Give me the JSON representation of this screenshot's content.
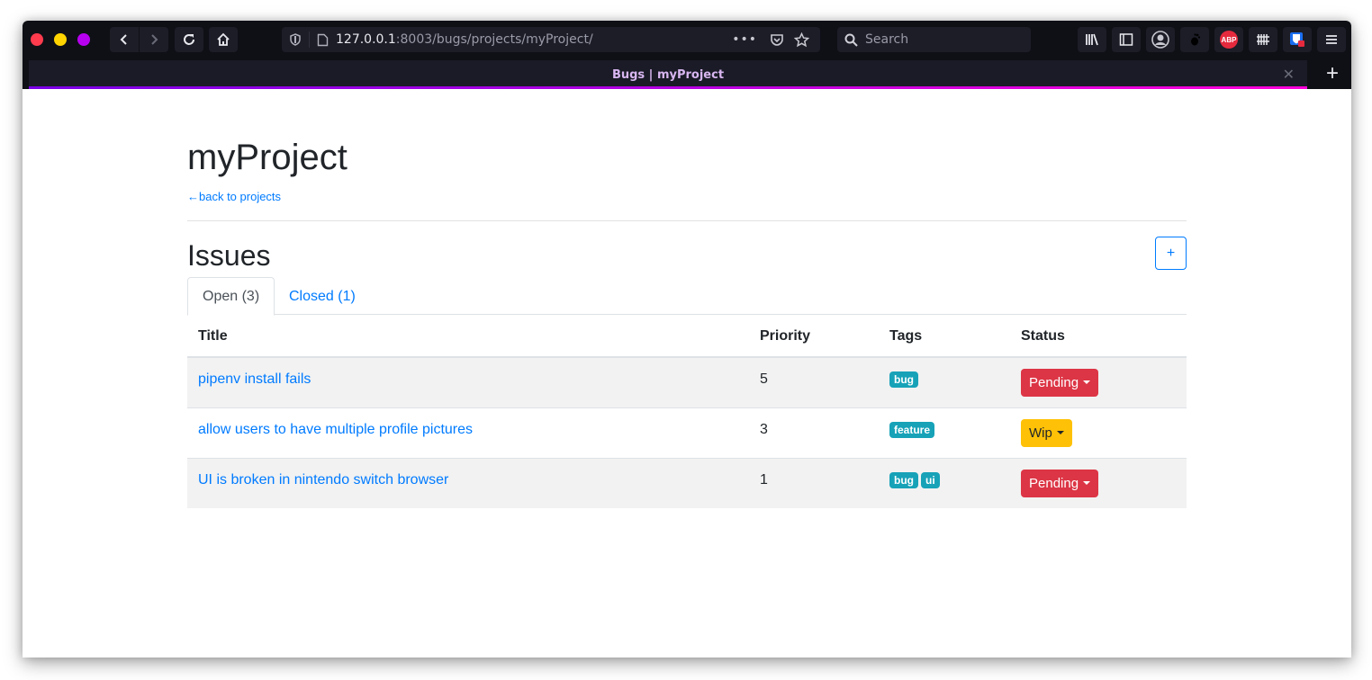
{
  "browser": {
    "traffic_lights": [
      {
        "name": "close",
        "color": "#ff3b4e"
      },
      {
        "name": "minimize",
        "color": "#ffd400"
      },
      {
        "name": "maximize",
        "color": "#b800f0"
      }
    ],
    "url_host": "127.0.0.1",
    "url_rest": ":8003/bugs/projects/myProject/",
    "search_placeholder": "Search",
    "tab_title": "Bugs | myProject",
    "toolbar_icons": [
      "library-icon",
      "sidebar-icon",
      "account-icon",
      "gnome-extension-icon",
      "adblock-plus-icon",
      "extension-icon",
      "bitwarden-icon",
      "menu-icon"
    ],
    "adblock_label": "ABP"
  },
  "page": {
    "project_title": "myProject",
    "back_link": "←back to projects",
    "section_title": "Issues",
    "add_button": "+",
    "tabs": [
      {
        "label": "Open (3)",
        "active": true
      },
      {
        "label": "Closed (1)",
        "active": false
      }
    ],
    "table": {
      "headers": [
        "Title",
        "Priority",
        "Tags",
        "Status"
      ],
      "rows": [
        {
          "title": "pipenv install fails",
          "priority": "5",
          "tags": [
            "bug"
          ],
          "status": "Pending",
          "status_color": "#dc3545",
          "status_text_color": "#ffffff"
        },
        {
          "title": "allow users to have multiple profile pictures",
          "priority": "3",
          "tags": [
            "feature"
          ],
          "status": "Wip",
          "status_color": "#ffc107",
          "status_text_color": "#212529"
        },
        {
          "title": "UI is broken in nintendo switch browser",
          "priority": "1",
          "tags": [
            "bug",
            "ui"
          ],
          "status": "Pending",
          "status_color": "#dc3545",
          "status_text_color": "#ffffff"
        }
      ]
    }
  },
  "colors": {
    "link": "#007bff",
    "badge": "#17a2b8",
    "stripe": "#f2f2f2"
  }
}
